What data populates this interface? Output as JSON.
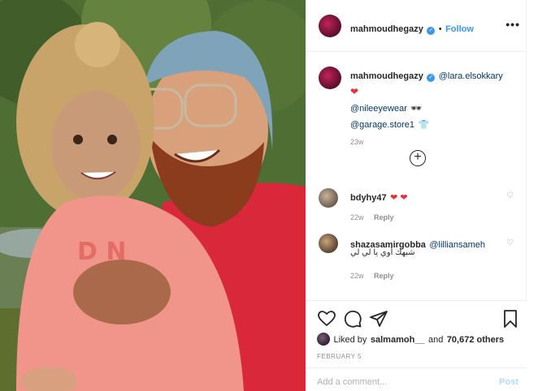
{
  "post": {
    "username": "mahmoudhegazy",
    "follow_label": "Follow",
    "more_label": "•••",
    "caption": {
      "username": "mahmoudhegazy",
      "mention_1": "@lara.elsokkary",
      "heart": "❤",
      "mention_2": "@nileeyewear",
      "mention_2_emoji": "🕶",
      "mention_3": "@garage.store1",
      "mention_3_emoji": "👕",
      "time": "23w"
    },
    "comments": [
      {
        "username": "bdyhy47",
        "text": "❤ ❤",
        "time": "22w",
        "reply": "Reply"
      },
      {
        "username": "shazasamirgobba",
        "mention": "@lilliansameh",
        "text": "شبهك أوي يا لي لي",
        "time": "22w",
        "reply": "Reply"
      }
    ],
    "likes": {
      "prefix": "Liked by",
      "user": "salmamoh__",
      "and": "and",
      "count": "70,672 others"
    },
    "date": "FEBRUARY 5",
    "add_comment_placeholder": "Add a comment...",
    "post_button": "Post"
  },
  "colors": {
    "accent": "#3897f0",
    "like_heart": "#ed2d3d",
    "muted": "#8e8e8e"
  },
  "icons": {
    "verified": "verified-badge-icon",
    "like": "heart-outline-icon",
    "comment": "comment-bubble-icon",
    "share": "paper-plane-icon",
    "save": "bookmark-icon",
    "load_more": "plus-circle-icon",
    "comment_like": "heart-outline-icon"
  }
}
